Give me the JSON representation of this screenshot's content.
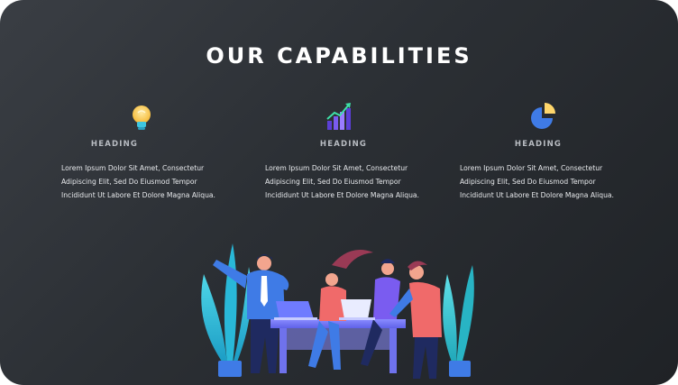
{
  "section": {
    "title": "OUR CAPABILITIES"
  },
  "capabilities": [
    {
      "icon": "lightbulb-icon",
      "heading": "HEADING",
      "body": "Lorem Ipsum Dolor Sit Amet, Consectetur\nAdipiscing Elit, Sed Do Eiusmod Tempor\nIncididunt Ut Labore Et Dolore Magna Aliqua."
    },
    {
      "icon": "growth-chart-icon",
      "heading": "HEADING",
      "body": "Lorem Ipsum Dolor Sit Amet, Consectetur\nAdipiscing Elit, Sed Do Eiusmod Tempor\nIncididunt Ut Labore Et Dolore Magna Aliqua."
    },
    {
      "icon": "pie-chart-icon",
      "heading": "HEADING",
      "body": "Lorem Ipsum Dolor Sit Amet, Consectetur\nAdipiscing Elit, Sed Do Eiusmod Tempor\nIncididunt Ut Labore Et Dolore Magna Aliqua."
    }
  ],
  "colors": {
    "background_dark": "#1f2226",
    "background_light": "#3a3e44",
    "accent_blue": "#3f7be6",
    "accent_yellow": "#ffd66b",
    "accent_purple": "#7a5cf0",
    "accent_teal": "#3ec6e0",
    "accent_coral": "#f06a6a"
  }
}
